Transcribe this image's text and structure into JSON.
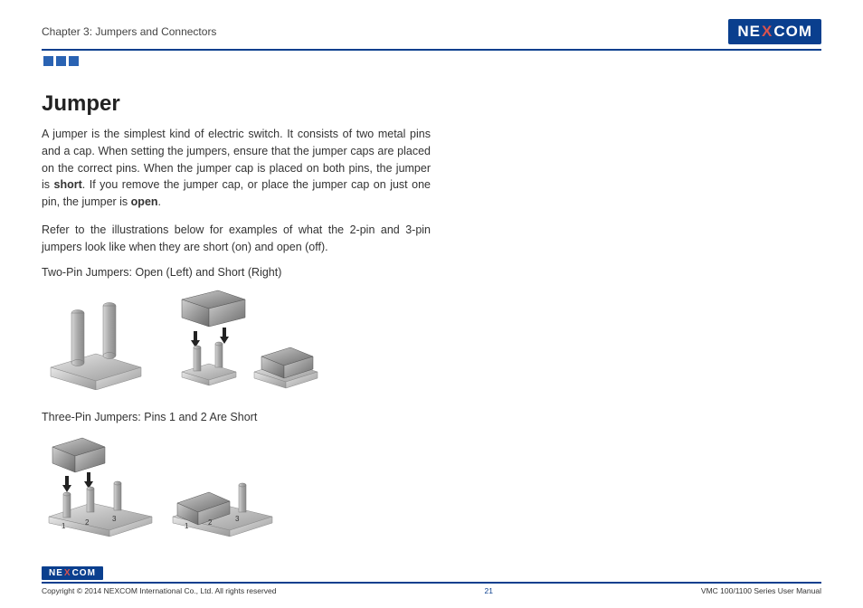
{
  "header": {
    "chapter": "Chapter 3: Jumpers and Connectors",
    "brand_pre": "NE",
    "brand_x": "X",
    "brand_post": "COM"
  },
  "main": {
    "title": "Jumper",
    "para1_pre": "A jumper is the simplest kind of electric switch. It consists of two metal pins and a cap. When setting the jumpers, ensure that the jumper caps are placed on the correct pins. When the jumper cap is placed on both pins, the jumper is ",
    "para1_b1": "short",
    "para1_mid": ". If you remove the jumper cap, or place the jumper cap on just one pin, the jumper is ",
    "para1_b2": "open",
    "para1_post": ".",
    "para2": "Refer to the illustrations below for examples of what the 2-pin and 3-pin jumpers look like when they are short (on) and open (off).",
    "caption1": "Two-Pin Jumpers: Open (Left) and Short (Right)",
    "caption2": "Three-Pin Jumpers: Pins 1 and 2 Are Short"
  },
  "footer": {
    "copyright": "Copyright © 2014 NEXCOM International Co., Ltd. All rights reserved",
    "page": "21",
    "docname": "VMC 100/1100 Series User Manual"
  }
}
